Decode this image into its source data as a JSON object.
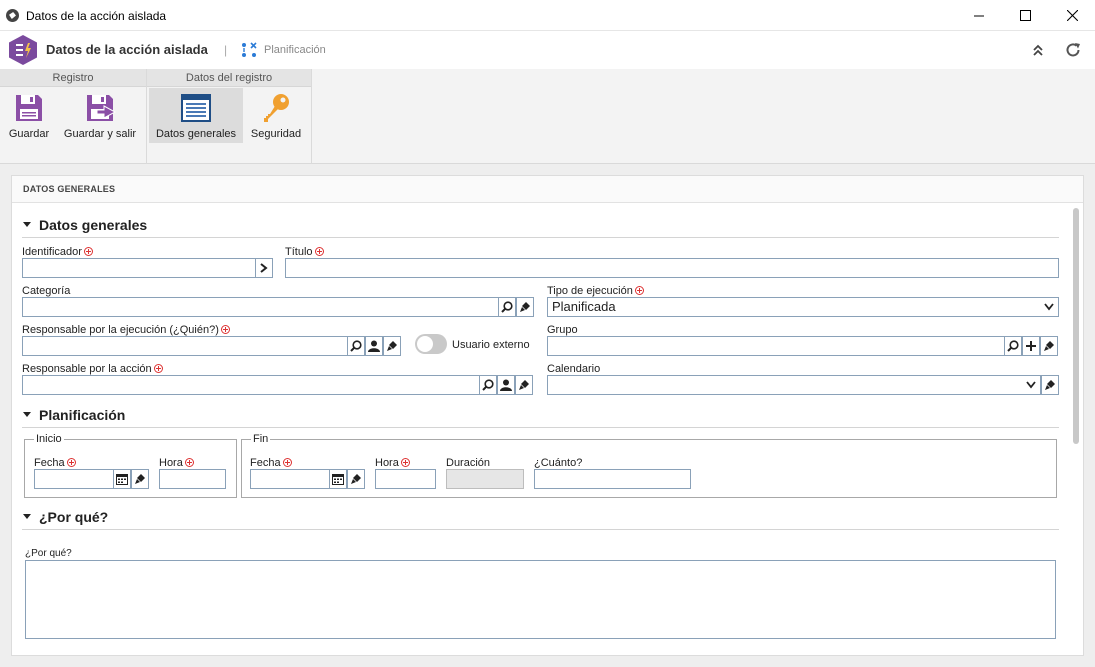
{
  "window": {
    "title": "Datos de la acción aislada"
  },
  "header": {
    "title": "Datos de la acción aislada",
    "separator": "|",
    "breadcrumb": "Planificación"
  },
  "ribbon": {
    "groups": [
      {
        "title": "Registro"
      },
      {
        "title": "Datos del registro"
      }
    ],
    "buttons": {
      "save": "Guardar",
      "save_exit": "Guardar y salir",
      "general_data": "Datos generales",
      "security": "Seguridad"
    }
  },
  "panel": {
    "header": "DATOS GENERALES"
  },
  "sections": {
    "general": "Datos generales",
    "planning": "Planificación",
    "why": "¿Por qué?"
  },
  "fields": {
    "identifier": {
      "label": "Identificador",
      "value": ""
    },
    "title": {
      "label": "Título",
      "value": ""
    },
    "category": {
      "label": "Categoría",
      "value": ""
    },
    "execution_type": {
      "label": "Tipo de ejecución",
      "value": "Planificada"
    },
    "responsible_execution": {
      "label": "Responsable por la ejecución (¿Quién?)",
      "value": ""
    },
    "external_user": {
      "label": "Usuario externo",
      "on": false
    },
    "group": {
      "label": "Grupo",
      "value": ""
    },
    "responsible_action": {
      "label": "Responsable por la acción",
      "value": ""
    },
    "calendar": {
      "label": "Calendario",
      "value": ""
    },
    "start": {
      "legend": "Inicio",
      "date_label": "Fecha",
      "date_value": "",
      "time_label": "Hora",
      "time_value": ""
    },
    "end": {
      "legend": "Fin",
      "date_label": "Fecha",
      "date_value": "",
      "time_label": "Hora",
      "time_value": "",
      "duration_label": "Duración",
      "duration_value": "",
      "how_much_label": "¿Cuánto?",
      "how_much_value": ""
    },
    "why": {
      "label": "¿Por qué?",
      "value": ""
    }
  },
  "colors": {
    "accent": "#7b4a9e",
    "key": "#f0a030",
    "input_border": "#8aa1b8"
  }
}
